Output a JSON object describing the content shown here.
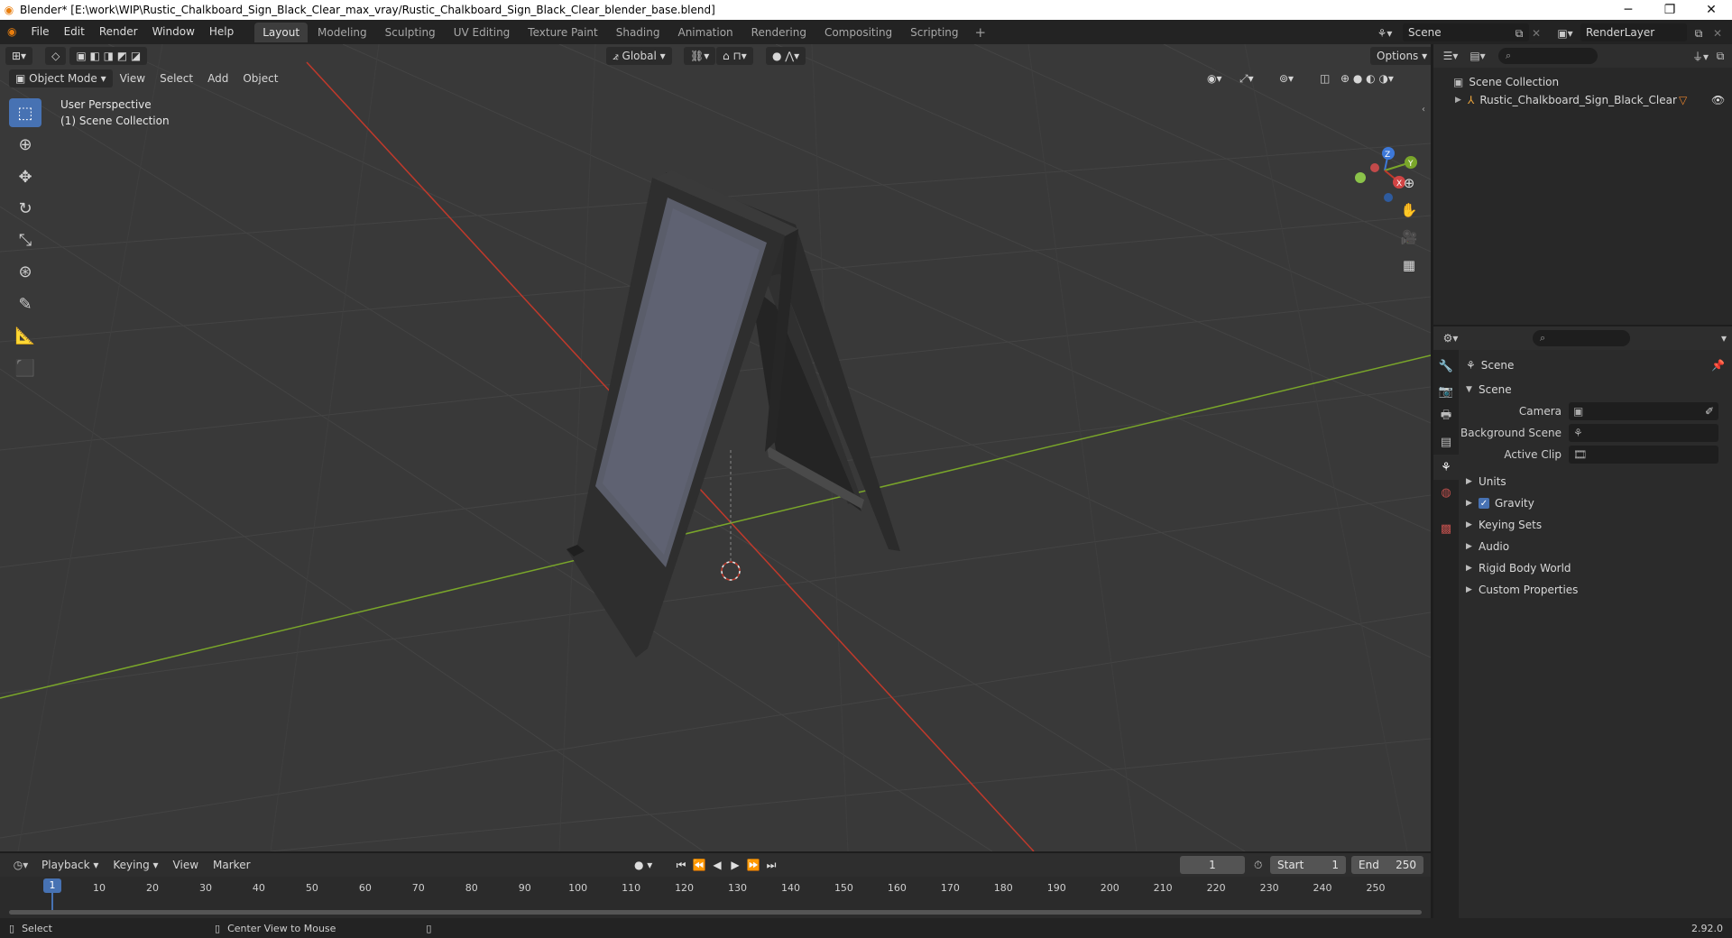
{
  "window": {
    "title": "Blender* [E:\\work\\WIP\\Rustic_Chalkboard_Sign_Black_Clear_max_vray/Rustic_Chalkboard_Sign_Black_Clear_blender_base.blend]",
    "minimize": "─",
    "maximize": "❐",
    "close": "✕"
  },
  "menu": [
    "File",
    "Edit",
    "Render",
    "Window",
    "Help"
  ],
  "workspaces": [
    "Layout",
    "Modeling",
    "Sculpting",
    "UV Editing",
    "Texture Paint",
    "Shading",
    "Animation",
    "Rendering",
    "Compositing",
    "Scripting"
  ],
  "active_workspace": "Layout",
  "add_workspace": "+",
  "scene_name": "Scene",
  "render_layer": "RenderLayer",
  "viewport": {
    "transform_orientation": "Global",
    "options_label": "Options",
    "mode": "Object Mode",
    "header_menus": [
      "View",
      "Select",
      "Add",
      "Object"
    ],
    "perspective_label": "User Perspective",
    "collection_label": "(1) Scene Collection",
    "gizmo_axes": {
      "z": "Z",
      "y": "Y",
      "x": "X"
    }
  },
  "outliner": {
    "root": "Scene Collection",
    "object": "Rustic_Chalkboard_Sign_Black_Clear"
  },
  "properties": {
    "header_title": "Scene",
    "panel_title": "Scene",
    "fields": [
      {
        "label": "Camera"
      },
      {
        "label": "Background Scene"
      },
      {
        "label": "Active Clip"
      }
    ],
    "subpanels": [
      "Units",
      "Gravity",
      "Keying Sets",
      "Audio",
      "Rigid Body World",
      "Custom Properties"
    ],
    "gravity_checked": true
  },
  "timeline": {
    "menus": [
      "Playback",
      "Keying",
      "View",
      "Marker"
    ],
    "current_frame": "1",
    "start_label": "Start",
    "start": "1",
    "end_label": "End",
    "end": "250",
    "ruler": [
      "1",
      "10",
      "20",
      "30",
      "40",
      "50",
      "60",
      "70",
      "80",
      "90",
      "100",
      "110",
      "120",
      "130",
      "140",
      "150",
      "160",
      "170",
      "180",
      "190",
      "200",
      "210",
      "220",
      "230",
      "240",
      "250"
    ]
  },
  "statusbar": {
    "select": "Select",
    "center_view": "Center View to Mouse",
    "version": "2.92.0"
  },
  "colors": {
    "accent": "#4772b3",
    "x_axis": "#c0392b",
    "y_axis": "#7aa62a",
    "background": "#393939"
  }
}
